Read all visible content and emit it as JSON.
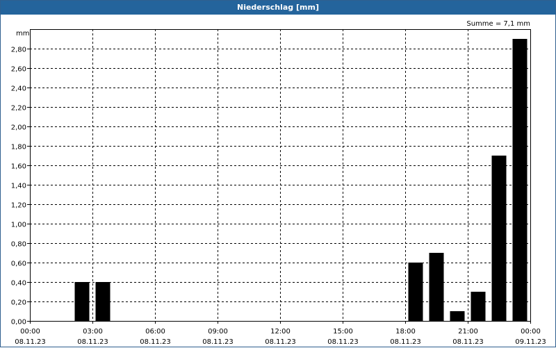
{
  "window": {
    "title": "Niederschlag [mm]"
  },
  "chart_data": {
    "type": "bar",
    "title": "Niederschlag [mm]",
    "ylabel": "mm",
    "annotation": "Summe = 7,1 mm",
    "ylim": [
      0,
      3.0
    ],
    "ytick_values": [
      0,
      0.2,
      0.4,
      0.6,
      0.8,
      1.0,
      1.2,
      1.4,
      1.6,
      1.8,
      2.0,
      2.2,
      2.4,
      2.6,
      2.8
    ],
    "ytick_labels": [
      "0,00",
      "0,20",
      "0,40",
      "0,60",
      "0,80",
      "1,00",
      "1,20",
      "1,40",
      "1,60",
      "1,80",
      "2,00",
      "2,20",
      "2,40",
      "2,60",
      "2,80"
    ],
    "xlim_hours": [
      0,
      24
    ],
    "xticks": [
      {
        "hour": 0,
        "time": "00:00",
        "date": "08.11.23"
      },
      {
        "hour": 3,
        "time": "03:00",
        "date": "08.11.23"
      },
      {
        "hour": 6,
        "time": "06:00",
        "date": "08.11.23"
      },
      {
        "hour": 9,
        "time": "09:00",
        "date": "08.11.23"
      },
      {
        "hour": 12,
        "time": "12:00",
        "date": "08.11.23"
      },
      {
        "hour": 15,
        "time": "15:00",
        "date": "08.11.23"
      },
      {
        "hour": 18,
        "time": "18:00",
        "date": "08.11.23"
      },
      {
        "hour": 21,
        "time": "21:00",
        "date": "08.11.23"
      },
      {
        "hour": 24,
        "time": "00:00",
        "date": "09.11.23"
      }
    ],
    "bars": [
      {
        "hour": 2.5,
        "value": 0.4
      },
      {
        "hour": 3.5,
        "value": 0.4
      },
      {
        "hour": 18.5,
        "value": 0.6
      },
      {
        "hour": 19.5,
        "value": 0.7
      },
      {
        "hour": 20.5,
        "value": 0.1
      },
      {
        "hour": 21.5,
        "value": 0.3
      },
      {
        "hour": 22.5,
        "value": 1.7
      },
      {
        "hour": 23.5,
        "value": 2.9
      }
    ],
    "grid": true,
    "colors": {
      "bar": "#000000",
      "titlebar": "#24649c"
    }
  }
}
